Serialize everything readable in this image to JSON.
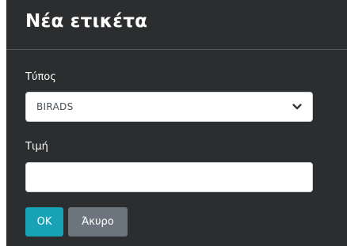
{
  "dialog": {
    "title": "Νέα ετικέτα",
    "type_label": "Τύπος",
    "type_select": {
      "selected": "BIRADS",
      "options": [
        "BIRADS"
      ]
    },
    "value_label": "Τιμή",
    "value_input": {
      "value": "",
      "placeholder": ""
    },
    "ok_label": "OK",
    "cancel_label": "Άκυρο"
  },
  "colors": {
    "dialog_bg": "#2b2d2f",
    "ok_button": "#17a2b8",
    "cancel_button": "#6c757d"
  },
  "icons": {
    "select_arrow": "chevron-down-icon"
  }
}
